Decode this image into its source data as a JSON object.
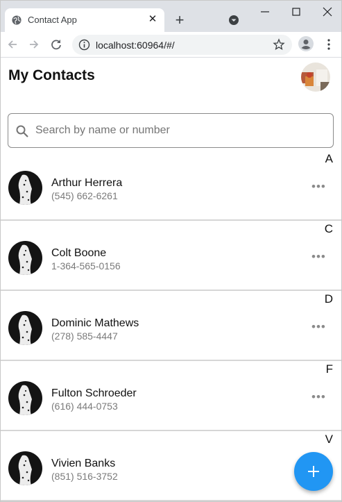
{
  "browser": {
    "tab_title": "Contact App",
    "url": "localhost:60964/#/",
    "icons": {
      "favicon": "globe-icon",
      "tab_close": "close-icon",
      "new_tab": "plus-icon",
      "tab_search": "chevron-down-circle-icon",
      "back": "arrow-left-icon",
      "forward": "arrow-right-icon",
      "reload": "reload-icon",
      "site_info": "info-icon",
      "bookmark": "star-icon",
      "profile": "profile-icon",
      "menu": "kebab-menu-icon"
    }
  },
  "app": {
    "title": "My Contacts",
    "search": {
      "placeholder": "Search by name or number"
    },
    "sections": [
      {
        "letter": "A",
        "contacts": [
          {
            "name": "Arthur Herrera",
            "phone": "(545) 662-6261"
          }
        ]
      },
      {
        "letter": "C",
        "contacts": [
          {
            "name": "Colt Boone",
            "phone": "1-364-565-0156"
          }
        ]
      },
      {
        "letter": "D",
        "contacts": [
          {
            "name": "Dominic Mathews",
            "phone": "(278) 585-4447"
          }
        ]
      },
      {
        "letter": "F",
        "contacts": [
          {
            "name": "Fulton Schroeder",
            "phone": "(616) 444-0753"
          }
        ]
      },
      {
        "letter": "V",
        "contacts": [
          {
            "name": "Vivien Banks",
            "phone": "(851) 516-3752"
          }
        ]
      }
    ],
    "fab": {
      "icon": "plus-icon"
    },
    "colors": {
      "accent": "#2196f3",
      "divider": "#d6d6d6",
      "secondary_text": "#7a7a7a"
    }
  }
}
